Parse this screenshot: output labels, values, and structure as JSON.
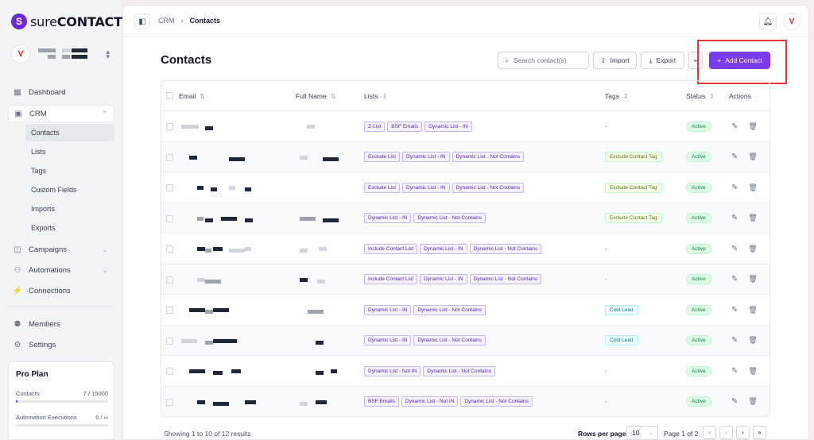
{
  "app": {
    "logo_prefix": "sure",
    "logo_suffix": "CONTACT",
    "avatar_initial": "V"
  },
  "sidebar": {
    "dashboard": "Dashboard",
    "crm": "CRM",
    "crm_sub": [
      "Contacts",
      "Lists",
      "Tags",
      "Custom Fields",
      "Imports",
      "Exports"
    ],
    "campaigns": "Campaigns",
    "automations": "Automations",
    "connections": "Connections",
    "members": "Members",
    "settings": "Settings"
  },
  "plan": {
    "title": "Pro Plan",
    "contacts_label": "Contacts",
    "contacts_value": "7 / 15000",
    "contacts_fraction": 0.0005,
    "automation_label": "Automation Executions",
    "automation_value": "0 / ∞"
  },
  "breadcrumb": {
    "root": "CRM",
    "current": "Contacts"
  },
  "page": {
    "title": "Contacts",
    "search_placeholder": "Search contact(s)",
    "import": "Import",
    "export": "Export",
    "add_contact": "Add Contact"
  },
  "table": {
    "headers": {
      "email": "Email",
      "full_name": "Full Name",
      "lists": "Lists",
      "tags": "Tags",
      "status": "Status",
      "actions": "Actions"
    },
    "rows": [
      {
        "lists": [
          "Z-List",
          "BSF Emails",
          "Dynamic List - IN"
        ],
        "tags": [],
        "tag_color": "",
        "status": "Active"
      },
      {
        "lists": [
          "Exclude List",
          "Dynamic List - IN",
          "Dynamic List - Not Contains"
        ],
        "tags": [
          "Exclude Contact Tag"
        ],
        "tag_color": "green",
        "status": "Active"
      },
      {
        "lists": [
          "Exclude List",
          "Dynamic List - IN",
          "Dynamic List - Not Contains"
        ],
        "tags": [
          "Exclude Contact Tag"
        ],
        "tag_color": "green",
        "status": "Active"
      },
      {
        "lists": [
          "Dynamic List - IN",
          "Dynamic List - Not Contains"
        ],
        "tags": [
          "Exclude Contact Tag"
        ],
        "tag_color": "green",
        "status": "Active"
      },
      {
        "lists": [
          "Include Contact List",
          "Dynamic List - IN",
          "Dynamic List - Not Contains"
        ],
        "tags": [],
        "tag_color": "",
        "status": "Active"
      },
      {
        "lists": [
          "Include Contact List",
          "Dynamic List - IN",
          "Dynamic List - Not Contains"
        ],
        "tags": [],
        "tag_color": "",
        "status": "Active"
      },
      {
        "lists": [
          "Dynamic List - IN",
          "Dynamic List - Not Contains"
        ],
        "tags": [
          "Cold Lead"
        ],
        "tag_color": "blue",
        "status": "Active"
      },
      {
        "lists": [
          "Dynamic List - IN",
          "Dynamic List - Not Contains"
        ],
        "tags": [
          "Cold Lead"
        ],
        "tag_color": "blue",
        "status": "Active"
      },
      {
        "lists": [
          "Dynamic List - Not IN",
          "Dynamic List - Not Contains"
        ],
        "tags": [],
        "tag_color": "",
        "status": "Active"
      },
      {
        "lists": [
          "BSF Emails",
          "Dynamic List - Not IN",
          "Dynamic List - Not Contains"
        ],
        "tags": [],
        "tag_color": "",
        "status": "Active"
      }
    ],
    "empty_tag": "-"
  },
  "footer": {
    "showing": "Showing 1 to 10 of 12 results",
    "rows_per_page_label": "Rows per page",
    "rows_per_page": "10",
    "page_info": "Page 1 of 2"
  }
}
